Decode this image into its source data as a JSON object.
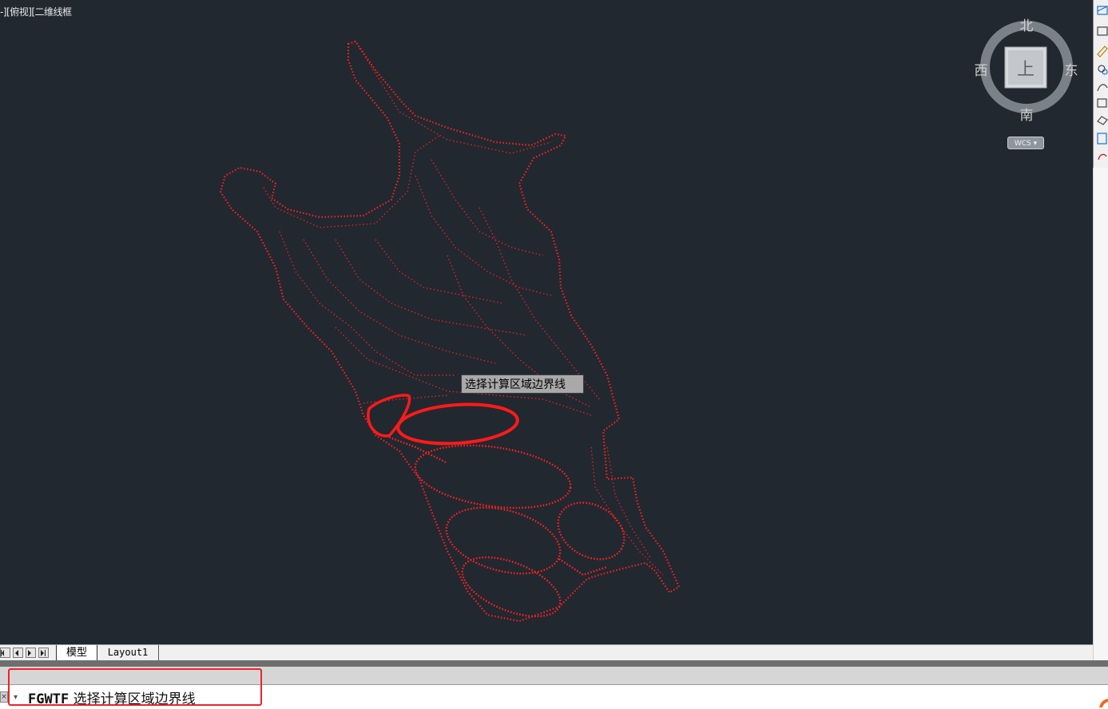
{
  "viewport": {
    "view_label": "-][俯视][二维线框",
    "tooltip": "选择计算区域边界线",
    "background": "#212830",
    "drawing_color": "#ff1a1a"
  },
  "viewcube": {
    "north": "北",
    "south": "南",
    "east": "东",
    "west": "西",
    "face": "上",
    "wcs_label": "WCS"
  },
  "tabs": {
    "model": "模型",
    "layout1": "Layout1"
  },
  "command": {
    "name": "FGWTF",
    "prompt": "选择计算区域边界线"
  },
  "colors": {
    "highlight_box": "#e8262a",
    "accent_blue": "#1e6fd0"
  },
  "icons": [
    "close-icon",
    "dropdown-arrow-icon",
    "nav-first-icon",
    "nav-prev-icon",
    "nav-next-icon",
    "nav-last-icon"
  ]
}
